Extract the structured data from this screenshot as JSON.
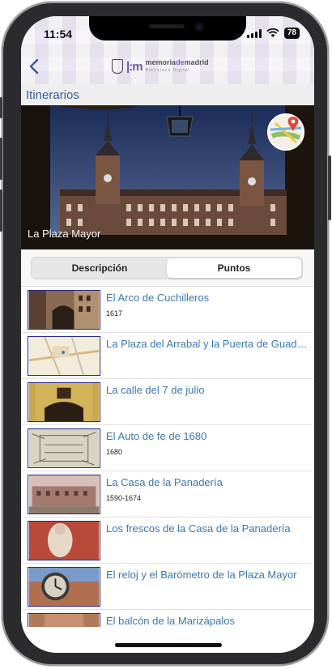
{
  "status": {
    "time": "11:54",
    "battery": "78"
  },
  "header": {
    "back_icon": "chevron-left-icon",
    "logo_text_main_a": "memoria",
    "logo_text_main_b": "de",
    "logo_text_main_c": "madrid",
    "logo_text_sub": "Biblioteca Digital"
  },
  "section": {
    "title": "Itinerarios"
  },
  "hero": {
    "title": "La Plaza Mayor",
    "map_icon": "map-pin-icon"
  },
  "tabs": [
    {
      "label": "Descripción",
      "active": false
    },
    {
      "label": "Puntos",
      "active": true
    }
  ],
  "items": [
    {
      "title": "El Arco de Cuchilleros",
      "subtitle": "1617"
    },
    {
      "title": "La Plaza del Arrabal y la Puerta de Guad…",
      "subtitle": ""
    },
    {
      "title": "La calle del 7 de julio",
      "subtitle": ""
    },
    {
      "title": "El Auto de fe de 1680",
      "subtitle": "1680"
    },
    {
      "title": "La Casa de la Panadería",
      "subtitle": "1590-1674"
    },
    {
      "title": "Los frescos de la Casa de la Panadería",
      "subtitle": ""
    },
    {
      "title": "El reloj y el Barómetro de la Plaza Mayor",
      "subtitle": ""
    },
    {
      "title": "El balcón de la Marizápalos",
      "subtitle": ""
    }
  ],
  "colors": {
    "link": "#3a78b8",
    "section_title": "#3a5ba8",
    "thumb_border": "#2a2a8a"
  }
}
